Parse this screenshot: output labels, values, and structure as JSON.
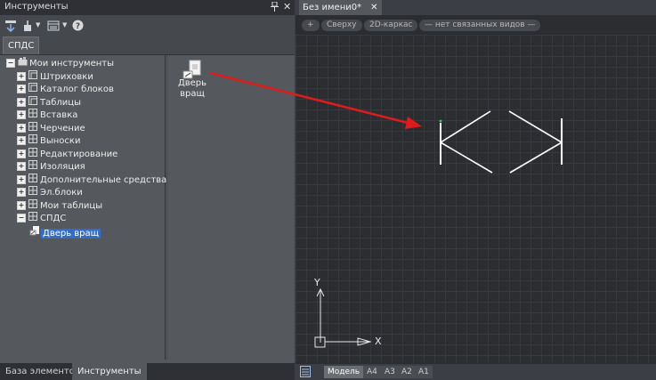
{
  "panel": {
    "title": "Инструменты",
    "pin_icon": "pin-icon",
    "close_glyph": "✕"
  },
  "tabs": {
    "active": "СПДС"
  },
  "tree": [
    {
      "label": "Мои инструменты",
      "expander": "−",
      "icon": "folder-icon",
      "indent": 0
    },
    {
      "label": "Штриховки",
      "expander": "+",
      "icon": "hatch-icon",
      "indent": 1
    },
    {
      "label": "Каталог блоков",
      "expander": "+",
      "icon": "hatch-icon",
      "indent": 1
    },
    {
      "label": "Таблицы",
      "expander": "+",
      "icon": "hatch-icon",
      "indent": 1
    },
    {
      "label": "Вставка",
      "expander": "+",
      "icon": "grid-icon",
      "indent": 1
    },
    {
      "label": "Черчение",
      "expander": "+",
      "icon": "grid-icon",
      "indent": 1
    },
    {
      "label": "Выноски",
      "expander": "+",
      "icon": "grid-icon",
      "indent": 1
    },
    {
      "label": "Редактирование",
      "expander": "+",
      "icon": "grid-icon",
      "indent": 1
    },
    {
      "label": "Изоляция",
      "expander": "+",
      "icon": "grid-icon",
      "indent": 1
    },
    {
      "label": "Дополнительные средства",
      "expander": "+",
      "icon": "grid-icon",
      "indent": 1
    },
    {
      "label": "Эл.блоки",
      "expander": "+",
      "icon": "grid-icon",
      "indent": 1
    },
    {
      "label": "Мои таблицы",
      "expander": "+",
      "icon": "grid-icon",
      "indent": 1
    },
    {
      "label": "СПДС",
      "expander": "−",
      "icon": "grid-icon",
      "indent": 1
    },
    {
      "label": "Дверь вращ",
      "expander": "",
      "icon": "door-tool-icon",
      "indent": 2,
      "selected": true
    }
  ],
  "content_item": {
    "line1": "Дверь",
    "line2": "вращ"
  },
  "bottom_tabs": [
    "База элементов",
    "Инструменты"
  ],
  "document": {
    "tab_title": "Без имени0*",
    "close_glyph": "✕"
  },
  "view_controls": [
    "+",
    "Сверху",
    "2D-каркас",
    "— нет связанных видов —"
  ],
  "axes": {
    "y": "Y",
    "x": "X"
  },
  "status_tabs": [
    "Модель",
    "A4",
    "A3",
    "A2",
    "A1"
  ],
  "colors": {
    "arrow": "#e01b1b",
    "selection": "#2f6fcc",
    "door_lines": "#ffffff"
  }
}
